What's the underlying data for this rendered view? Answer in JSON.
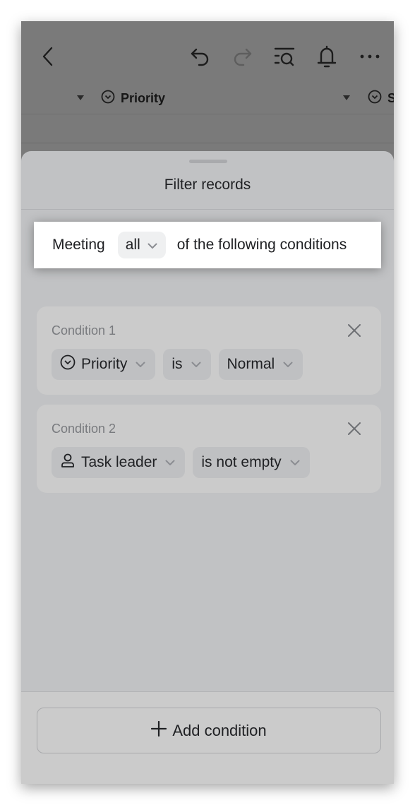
{
  "nav": {
    "icons": [
      "back-icon",
      "undo-icon",
      "redo-icon",
      "search-list-icon",
      "bell-icon",
      "more-icon"
    ]
  },
  "columns": [
    {
      "label": "Priority",
      "icon": "single-select-icon"
    },
    {
      "label": "S",
      "icon": "single-select-icon"
    }
  ],
  "sheet": {
    "title": "Filter records",
    "match": {
      "prefix": "Meeting",
      "mode": "all",
      "suffix": "of the following conditions"
    },
    "conditions": [
      {
        "label": "Condition 1",
        "field": "Priority",
        "field_icon": "single-select-icon",
        "operator": "is",
        "value": "Normal"
      },
      {
        "label": "Condition 2",
        "field": "Task leader",
        "field_icon": "person-icon",
        "operator": "is not empty"
      }
    ],
    "add_label": "Add condition"
  },
  "colors": {
    "backdrop": "#7a7a7a",
    "sheet": "#c1c2c4",
    "card": "#cbcbcb",
    "pill": "#bfc0c2",
    "text": "#1f2023",
    "muted": "#787a7e"
  }
}
